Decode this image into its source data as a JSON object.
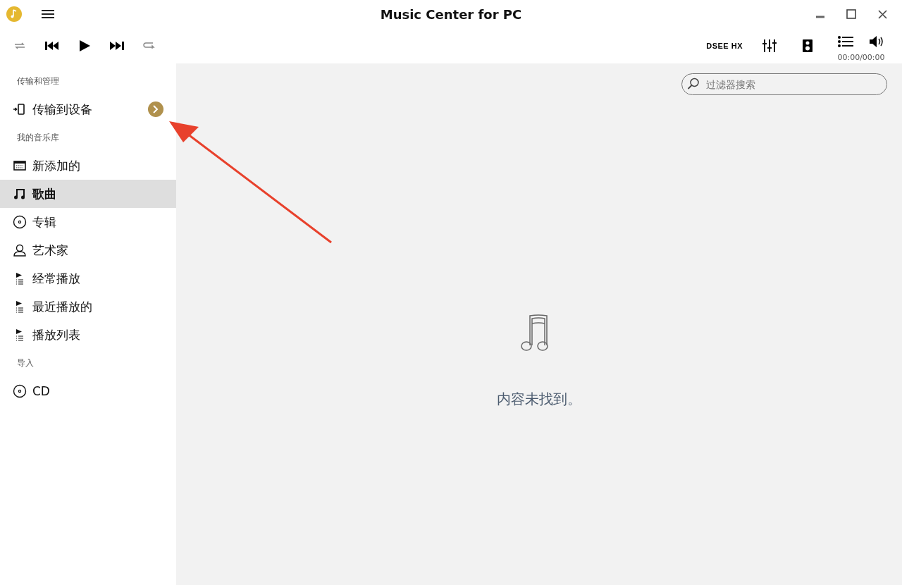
{
  "window": {
    "title": "Music Center for PC"
  },
  "toolbar": {
    "dsee": "DSEE HX",
    "time": "00:00/00:00"
  },
  "sidebar": {
    "sections": [
      {
        "header": "传输和管理",
        "items": [
          {
            "label": "传输到设备",
            "selected": false
          }
        ]
      },
      {
        "header": "我的音乐库",
        "items": [
          {
            "label": "新添加的",
            "selected": false
          },
          {
            "label": "歌曲",
            "selected": true
          },
          {
            "label": "专辑",
            "selected": false
          },
          {
            "label": "艺术家",
            "selected": false
          },
          {
            "label": "经常播放",
            "selected": false
          },
          {
            "label": "最近播放的",
            "selected": false
          },
          {
            "label": "播放列表",
            "selected": false
          }
        ]
      },
      {
        "header": "导入",
        "items": [
          {
            "label": "CD",
            "selected": false
          }
        ]
      }
    ]
  },
  "search": {
    "placeholder": "过滤器搜索"
  },
  "empty_state": {
    "message": "内容未找到。"
  }
}
